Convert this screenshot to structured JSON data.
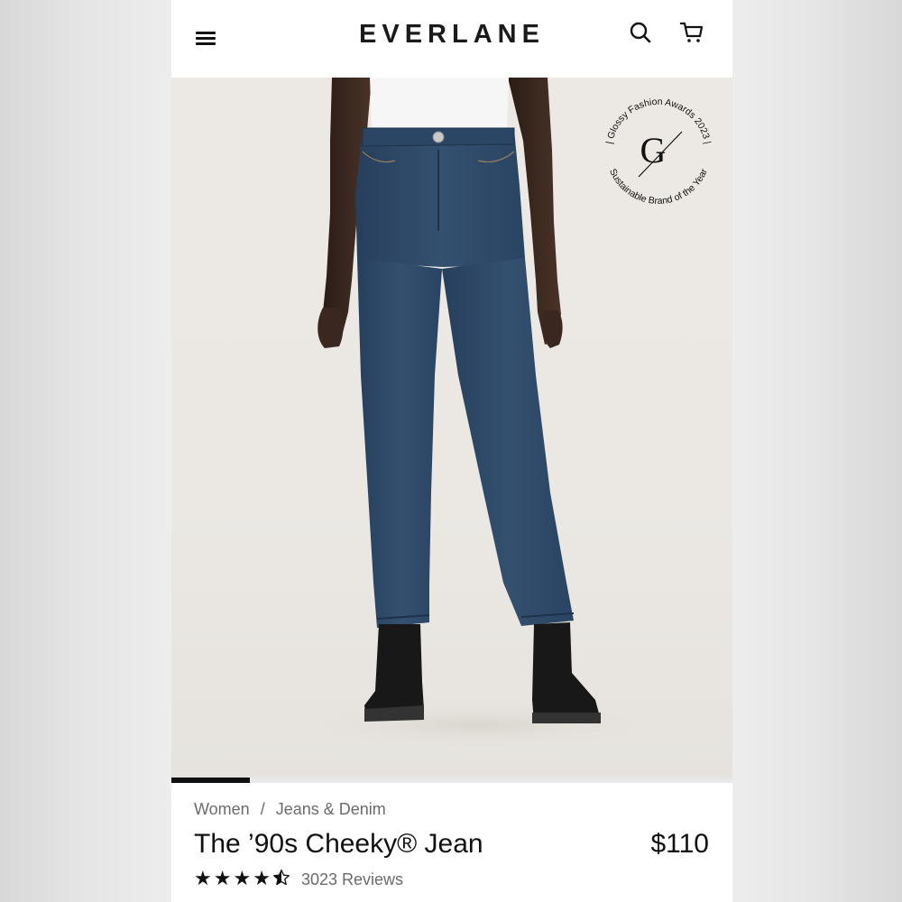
{
  "header": {
    "logo": "EVERLANE",
    "menu_icon": "hamburger-menu-icon",
    "search_icon": "search-icon",
    "cart_icon": "shopping-cart-icon"
  },
  "hero": {
    "image": "model-wearing-jeans-and-boots",
    "badge": {
      "ring_text_top": "| Glossy Fashion Awards 2023 |",
      "ring_text_bottom": "Sustainable Brand of the Year",
      "logo_letter": "G"
    },
    "carousel_progress": 0.14
  },
  "product": {
    "breadcrumb": [
      "Women",
      "Jeans & Denim"
    ],
    "breadcrumb_separator": "/",
    "title": "The ’90s Cheeky® Jean",
    "price": "$110",
    "rating": 4.5,
    "reviews_label": "3023 Reviews"
  },
  "colors": {
    "denim": "#2f4a6a",
    "background": "#ece9e5",
    "text": "#111111",
    "muted": "#6b6b6b"
  }
}
